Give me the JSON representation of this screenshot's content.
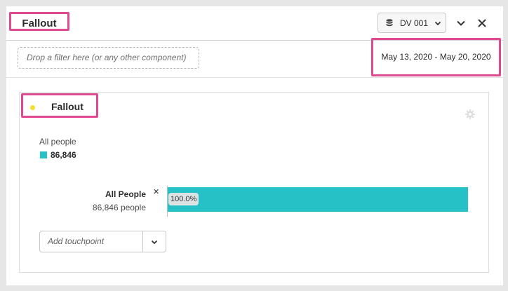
{
  "header": {
    "title": "Fallout",
    "datasource_label": "DV 001"
  },
  "filter_bar": {
    "dropzone_placeholder": "Drop a filter here (or any other component)",
    "date_range": "May 13, 2020 - May 20, 2020"
  },
  "visualization": {
    "title": "Fallout",
    "legend": {
      "label": "All people",
      "value": "86,846",
      "color": "#26c0c7"
    },
    "rows": [
      {
        "label": "All People",
        "sub": "86,846 people",
        "percent_label": "100.0%",
        "fill_fraction": 1.0
      }
    ],
    "add_touchpoint_placeholder": "Add touchpoint"
  },
  "colors": {
    "highlight": "#e0488f",
    "bar": "#26c0c7",
    "status_dot": "#f3df2e"
  }
}
